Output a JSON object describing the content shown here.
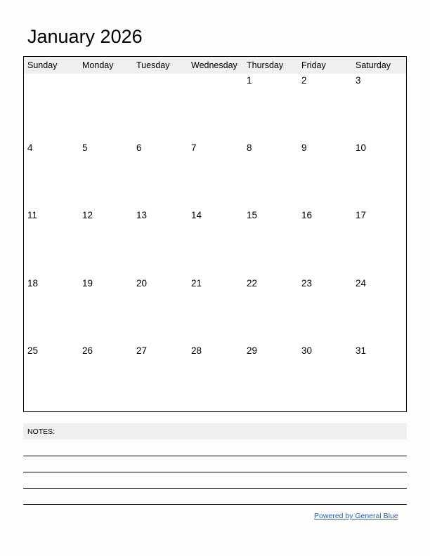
{
  "title": "January 2026",
  "weekdays": [
    "Sunday",
    "Monday",
    "Tuesday",
    "Wednesday",
    "Thursday",
    "Friday",
    "Saturday"
  ],
  "weeks": [
    [
      "",
      "",
      "",
      "",
      "1",
      "2",
      "3"
    ],
    [
      "4",
      "5",
      "6",
      "7",
      "8",
      "9",
      "10"
    ],
    [
      "11",
      "12",
      "13",
      "14",
      "15",
      "16",
      "17"
    ],
    [
      "18",
      "19",
      "20",
      "21",
      "22",
      "23",
      "24"
    ],
    [
      "25",
      "26",
      "27",
      "28",
      "29",
      "30",
      "31"
    ]
  ],
  "notes": {
    "label": "NOTES:"
  },
  "footer": {
    "link_text": "Powered by General Blue"
  },
  "colors": {
    "header_bg": "#efefef",
    "link": "#1f63b3"
  }
}
